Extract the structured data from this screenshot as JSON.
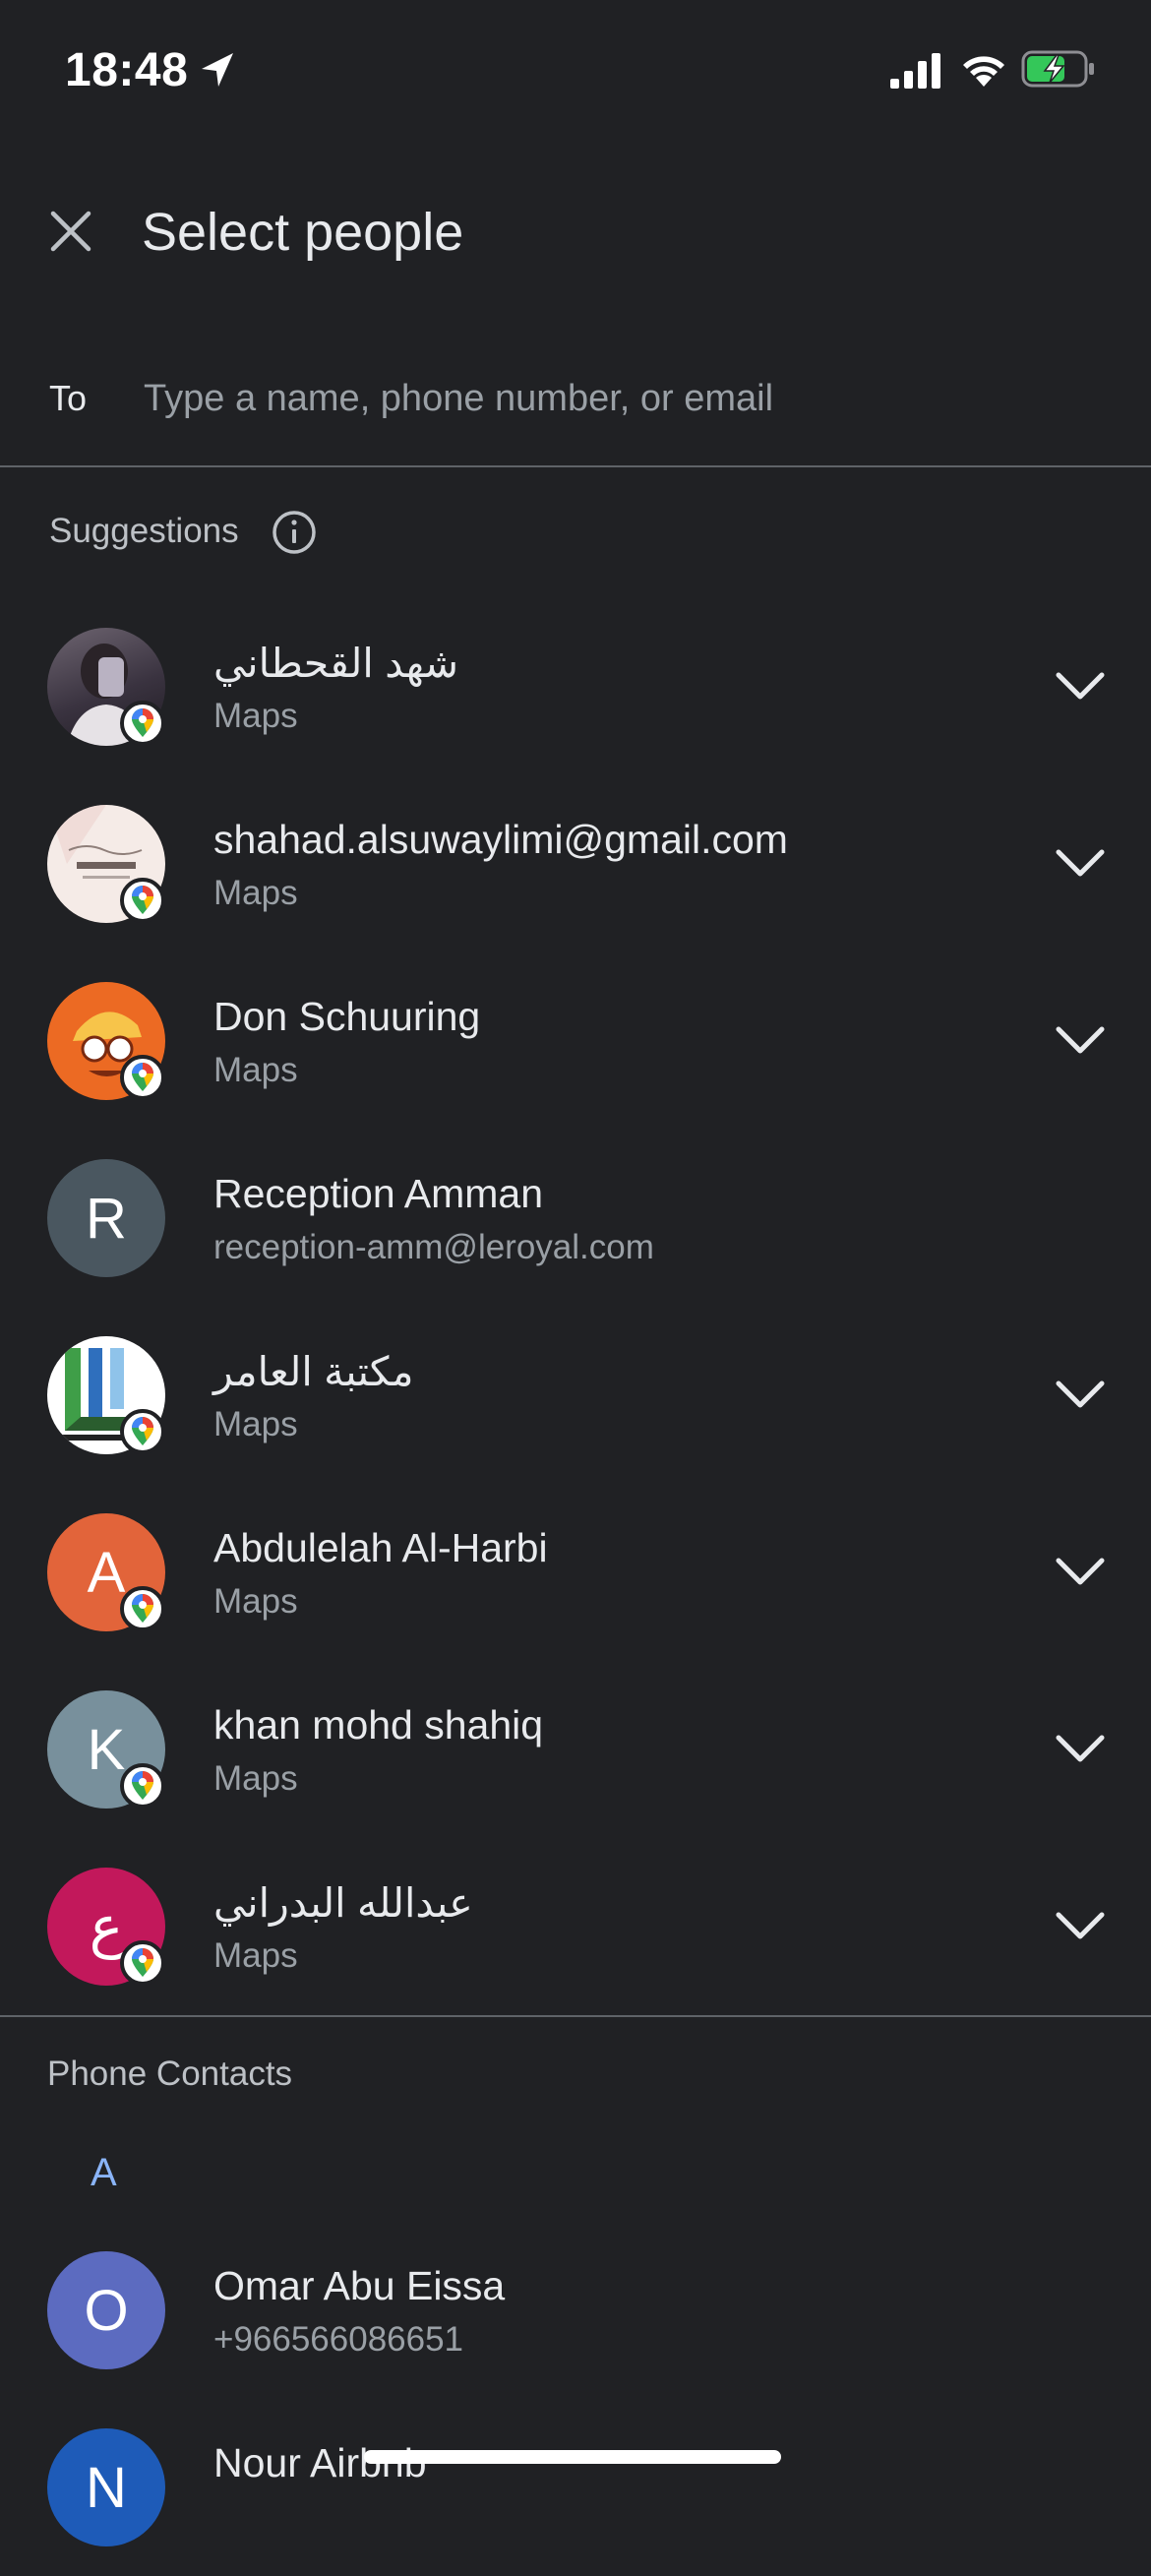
{
  "status_bar": {
    "time": "18:48"
  },
  "header": {
    "title": "Select people"
  },
  "to_field": {
    "label": "To",
    "placeholder": "Type a name, phone number, or email"
  },
  "suggestions": {
    "label": "Suggestions",
    "items": [
      {
        "name": "شهد القحطاني",
        "sub": "Maps",
        "avatar_type": "photo-person",
        "avatar_color": "#3b3540",
        "has_maps_badge": true,
        "expandable": true
      },
      {
        "name": "shahad.alsuwaylimi@gmail.com",
        "sub": "Maps",
        "avatar_type": "photo-logo-shahad",
        "avatar_color": "#f3e7e3",
        "has_maps_badge": true,
        "expandable": true
      },
      {
        "name": "Don Schuuring",
        "sub": "Maps",
        "avatar_type": "photo-cartoon",
        "avatar_color": "#ec6a23",
        "has_maps_badge": true,
        "expandable": true
      },
      {
        "name": "Reception Amman",
        "sub": "reception-amm@leroyal.com",
        "avatar_letter": "R",
        "avatar_color": "#4a5760",
        "has_maps_badge": false,
        "expandable": false
      },
      {
        "name": "مكتبة العامر",
        "sub": "Maps",
        "avatar_type": "photo-logo-library",
        "avatar_color": "#ffffff",
        "has_maps_badge": true,
        "expandable": true
      },
      {
        "name": "Abdulelah Al-Harbi",
        "sub": "Maps",
        "avatar_letter": "A",
        "avatar_color": "#e2643a",
        "has_maps_badge": true,
        "expandable": true
      },
      {
        "name": "khan mohd shahiq",
        "sub": "Maps",
        "avatar_letter": "K",
        "avatar_color": "#78909c",
        "has_maps_badge": true,
        "expandable": true
      },
      {
        "name": "عبدالله البدراني",
        "sub": "Maps",
        "avatar_letter": "ع",
        "avatar_color": "#c2185b",
        "has_maps_badge": true,
        "expandable": true
      }
    ]
  },
  "phone_contacts": {
    "label": "Phone Contacts",
    "index_letter": "A",
    "items": [
      {
        "name": "Omar Abu Eissa",
        "sub": "+966566086651",
        "avatar_letter": "O",
        "avatar_color": "#5c6bc0"
      },
      {
        "name": "Nour Airbnb",
        "sub": "",
        "avatar_letter": "N",
        "avatar_color": "#1e5bb8"
      }
    ]
  },
  "icons": {
    "close": "close-icon",
    "info": "info-icon",
    "expand": "chevron-down-icon",
    "maps_badge": "google-maps-pin-icon"
  }
}
